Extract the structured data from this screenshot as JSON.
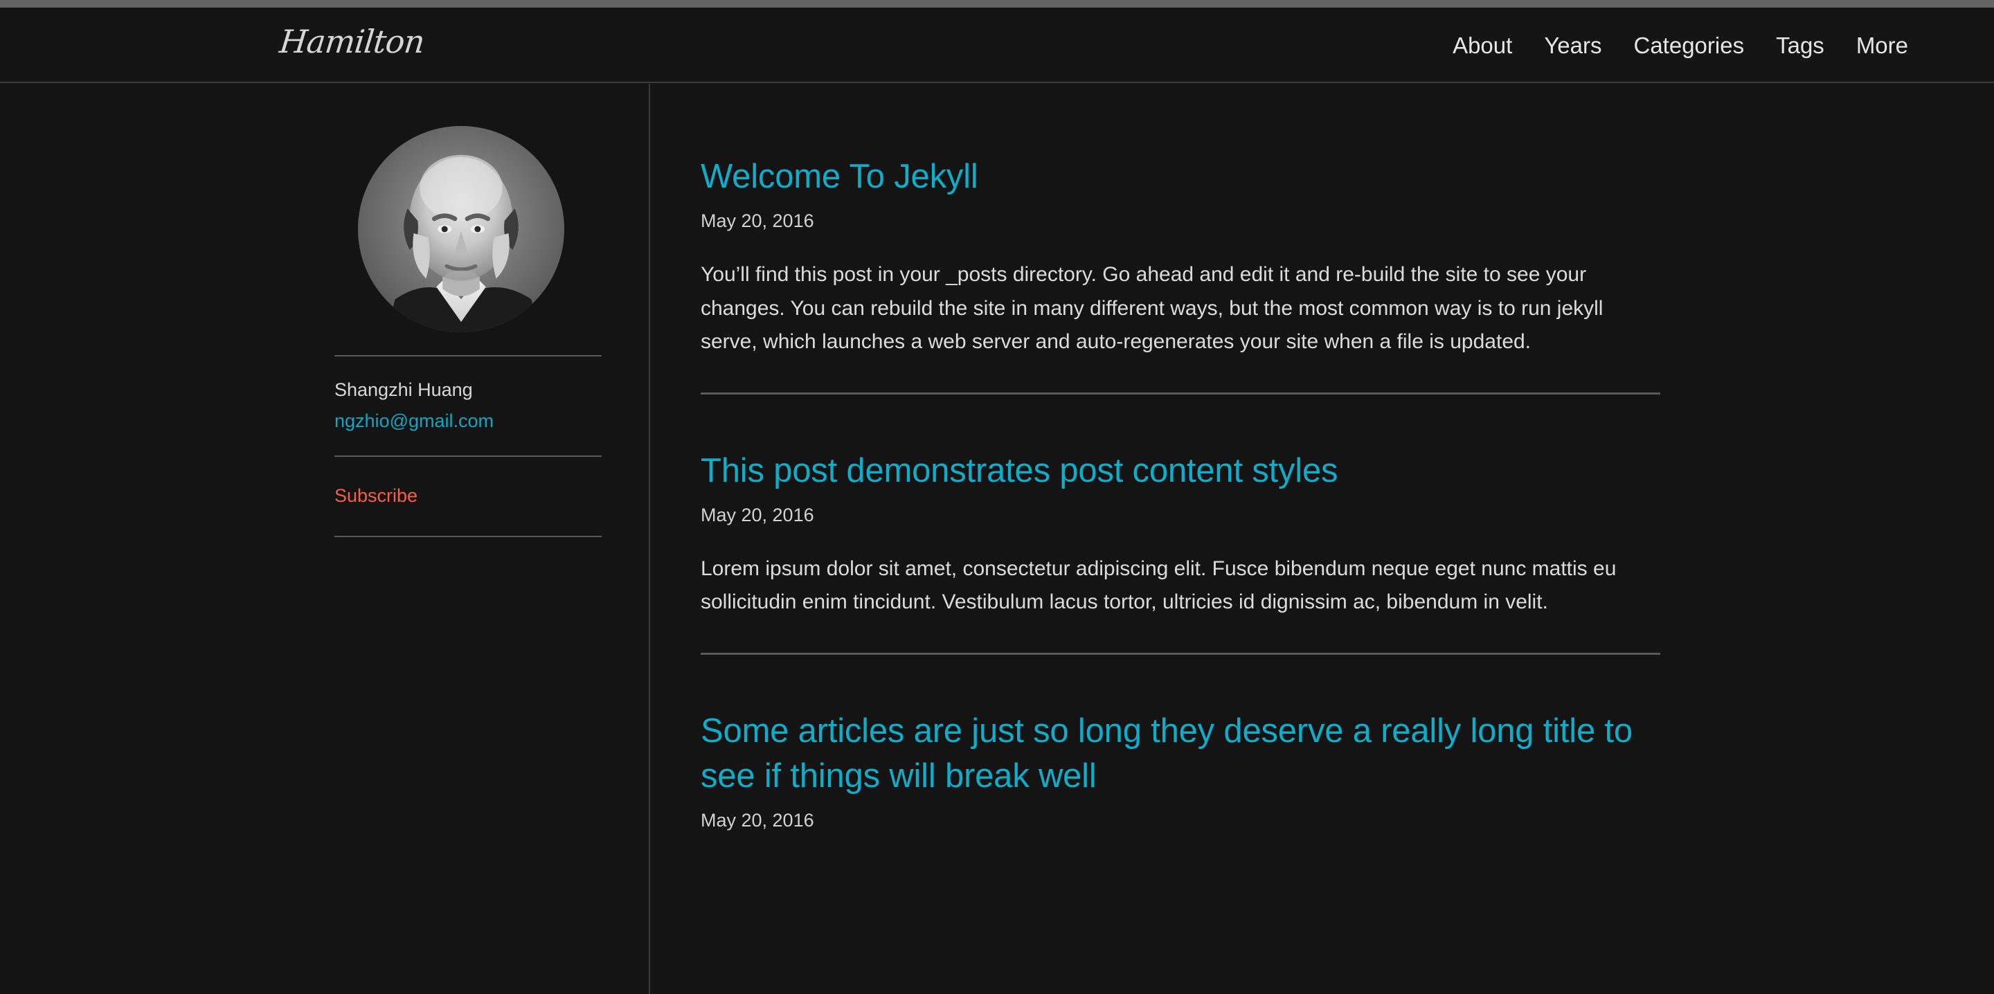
{
  "browser": {
    "chrome_bar_color": "#646464"
  },
  "header": {
    "logo": "Hamilton",
    "nav": [
      {
        "label": "About"
      },
      {
        "label": "Years"
      },
      {
        "label": "Categories"
      },
      {
        "label": "Tags"
      },
      {
        "label": "More"
      }
    ]
  },
  "sidebar": {
    "avatar_alt": "portrait-avatar",
    "author_name": "Shangzhi Huang",
    "author_email": "ngzhio@gmail.com",
    "subscribe_label": "Subscribe"
  },
  "main": {
    "posts": [
      {
        "title": "Welcome To Jekyll",
        "date": "May 20, 2016",
        "excerpt": "You’ll find this post in your _posts directory. Go ahead and edit it and re-build the site to see your changes. You can rebuild the site in many different ways, but the most common way is to run jekyll serve, which launches a web server and auto-regenerates your site when a file is updated."
      },
      {
        "title": "This post demonstrates post content styles",
        "date": "May 20, 2016",
        "excerpt": "Lorem ipsum dolor sit amet, consectetur adipiscing elit. Fusce bibendum neque eget nunc mattis eu sollicitudin enim tincidunt. Vestibulum lacus tortor, ultricies id dignissim ac, bibendum in velit."
      },
      {
        "title": "Some articles are just so long they deserve a really long title to see if things will break well",
        "date": "May 20, 2016",
        "excerpt": ""
      }
    ]
  },
  "colors": {
    "background": "#141414",
    "link_cyan": "#0eaecb",
    "accent_orange": "#fa5d45",
    "text_light": "#dcdcdc",
    "divider": "#5a5a5a"
  }
}
